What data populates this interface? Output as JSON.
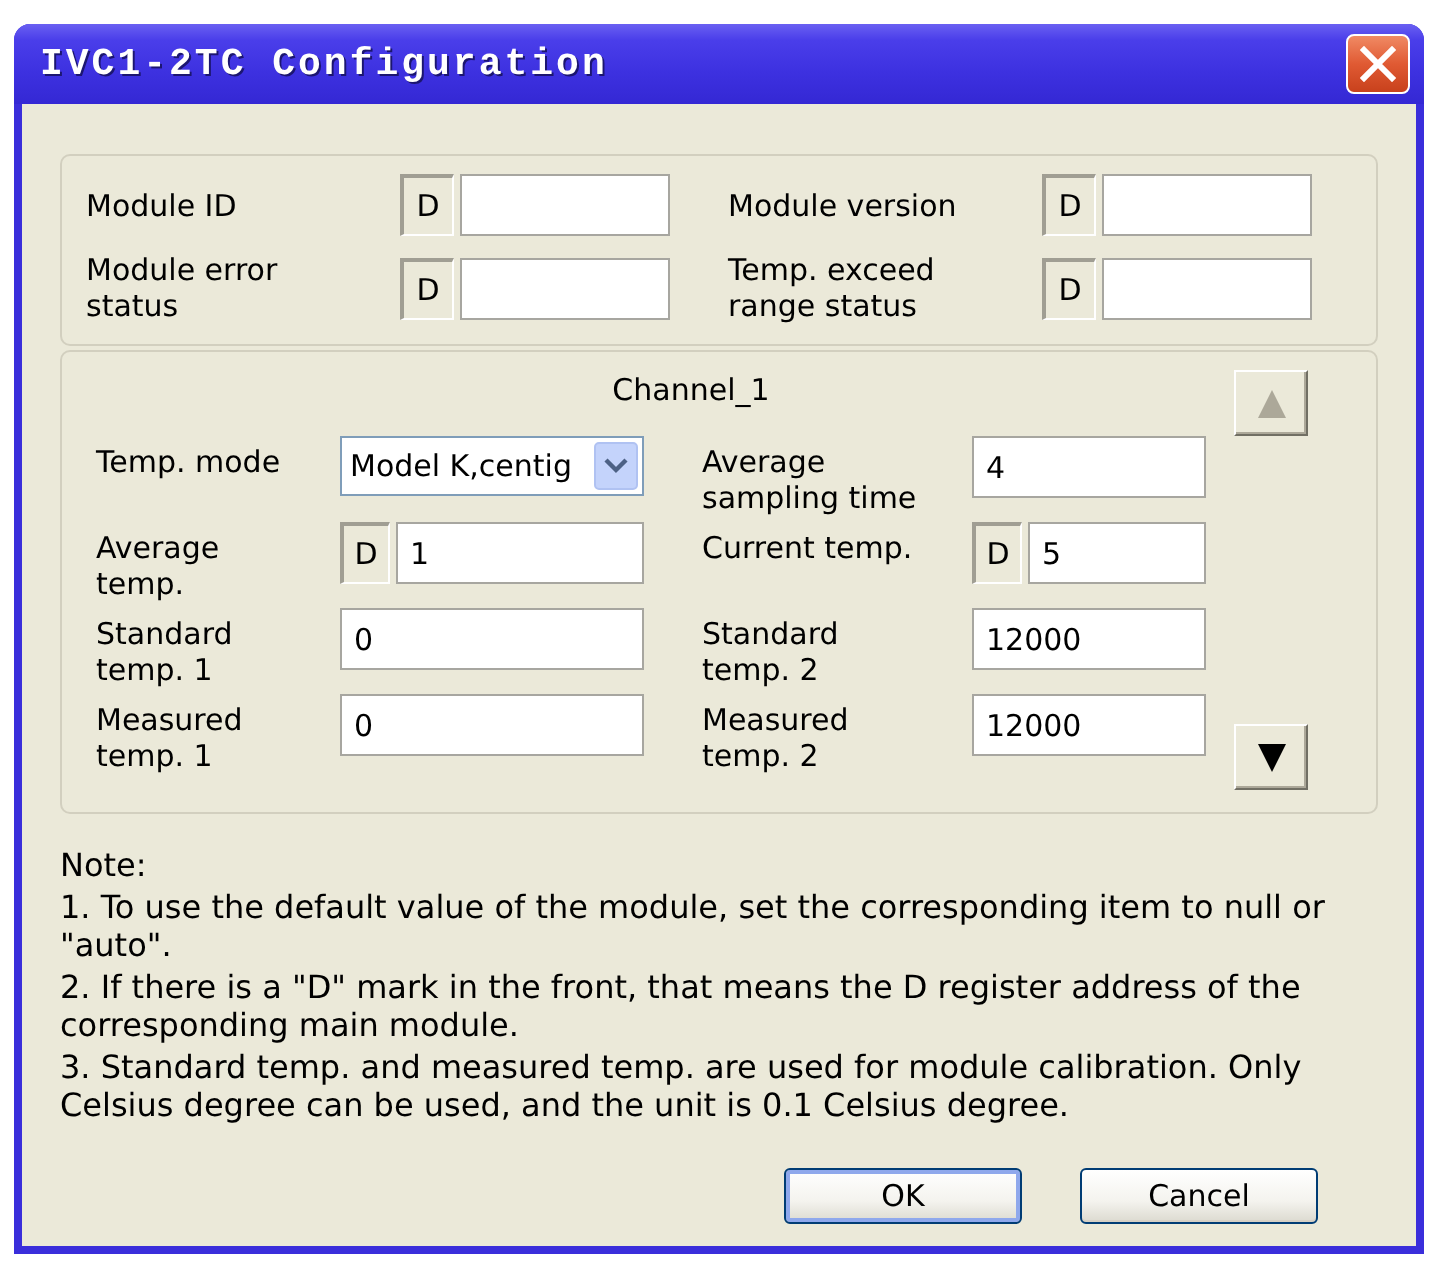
{
  "window": {
    "title": "IVC1-2TC Configuration"
  },
  "module_info": {
    "fields": [
      {
        "label": "Module ID",
        "prefix": "D"
      },
      {
        "label": "Module version",
        "prefix": "D"
      },
      {
        "label": "Module error status",
        "prefix": "D"
      },
      {
        "label": "Temp. exceed range status",
        "prefix": "D"
      }
    ]
  },
  "channel": {
    "title": "Channel_1",
    "scroll_up": {
      "disabled": true
    },
    "scroll_down": {
      "disabled": false
    },
    "fields": [
      {
        "kind": "select",
        "label": "Temp. mode",
        "value": "Model K,centig"
      },
      {
        "kind": "text",
        "label": "Average sampling time",
        "value": "4"
      },
      {
        "kind": "prefixed",
        "label": "Average temp.",
        "prefix": "D",
        "value": "1"
      },
      {
        "kind": "prefixed",
        "label": "Current temp.",
        "prefix": "D",
        "value": "5"
      },
      {
        "kind": "text",
        "label": "Standard temp. 1",
        "value": "0"
      },
      {
        "kind": "text",
        "label": "Standard temp. 2",
        "value": "12000"
      },
      {
        "kind": "text",
        "label": "Measured temp. 1",
        "value": "0"
      },
      {
        "kind": "text",
        "label": "Measured temp. 2",
        "value": "12000"
      }
    ]
  },
  "note": {
    "heading": "Note:",
    "items": [
      "1. To use the default value of the module, set the corresponding item to null or \"auto\".",
      "2. If there is a \"D\" mark in the front, that means the D register address of the corresponding main module.",
      "3. Standard temp. and measured temp. are used for module calibration. Only Celsius degree can be used, and the unit is 0.1 Celsius degree."
    ]
  },
  "buttons": [
    {
      "label": "OK",
      "default": true
    },
    {
      "label": "Cancel",
      "default": false
    }
  ]
}
